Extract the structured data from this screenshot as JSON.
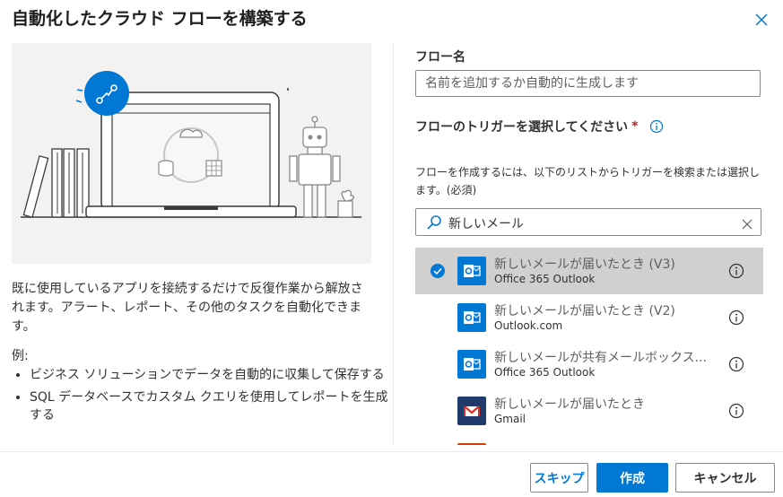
{
  "dialog": {
    "title": "自動化したクラウド フローを構築する"
  },
  "left": {
    "description": "既に使用しているアプリを接続するだけで反復作業から解放されます。アラート、レポート、その他のタスクを自動化できます。",
    "examples_label": "例:",
    "examples": [
      "ビジネス ソリューションでデータを自動的に収集して保存する",
      "SQL データベースでカスタム クエリを使用してレポートを生成する"
    ]
  },
  "form": {
    "flow_name_label": "フロー名",
    "flow_name_placeholder": "名前を追加するか自動的に生成します",
    "trigger_label": "フローのトリガーを選択してください",
    "required_mark": "*",
    "trigger_help": "フローを作成するには、以下のリストからトリガーを検索または選択します。(必須)",
    "search_value": "新しいメール"
  },
  "triggers": [
    {
      "name": "新しいメールが届いたとき (V3)",
      "connector": "Office 365 Outlook",
      "icon": "outlook-icon",
      "color": "#0078d4",
      "selected": true
    },
    {
      "name": "新しいメールが届いたとき (V2)",
      "connector": "Outlook.com",
      "icon": "outlook-icon",
      "color": "#0078d4",
      "selected": false
    },
    {
      "name": "新しいメールが共有メールボックス...",
      "connector": "Office 365 Outlook",
      "icon": "outlook-icon",
      "color": "#0078d4",
      "selected": false
    },
    {
      "name": "新しいメールが届いたとき",
      "connector": "Gmail",
      "icon": "gmail-icon",
      "color": "#1f3a6b",
      "selected": false
    }
  ],
  "footer": {
    "skip_label": "スキップ",
    "create_label": "作成",
    "cancel_label": "キャンセル"
  },
  "colors": {
    "accent": "#0078d4",
    "selected_row": "#d2d0ce",
    "required": "#a4262c"
  }
}
